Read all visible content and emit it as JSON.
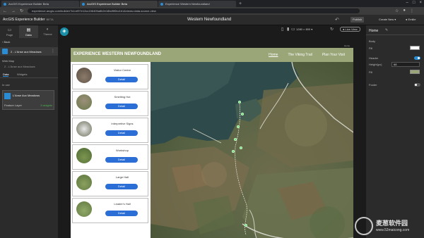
{
  "browser": {
    "tabs": [
      {
        "label": "ArcGIS Experience Builder Beta"
      },
      {
        "label": "ArcGIS Experience Builder Beta"
      },
      {
        "label": "Experience Western Newfoundland"
      }
    ],
    "url": "experience.arcgis.com/builder/?id=ef97e12cc156405a8b2e18bd9f0bc1b1&views=data-source-view"
  },
  "builder": {
    "app_title": "ArcGIS Experience Builder",
    "beta": "BETA",
    "page_title": "Western Newfoundland",
    "publish": "Publish",
    "create_new": "Create New",
    "user": "Emilie",
    "resolution": "1280 × 800",
    "live_view": "Live View",
    "page_label": "Home"
  },
  "left_rail": {
    "tabs": [
      {
        "label": "Page",
        "icon": "page-icon"
      },
      {
        "label": "Data",
        "icon": "data-icon"
      },
      {
        "label": "Theme",
        "icon": "theme-icon"
      }
    ]
  },
  "left_panel": {
    "back": "Back",
    "widget_name": "2 - L'Anse aux Meadows",
    "web_map_label": "Web Map",
    "web_map_item": "2 - L'Anse aux Meadows",
    "tabs": [
      "Data",
      "Widgets"
    ],
    "in_use": "In use",
    "data_source": {
      "name": "L'Anse Aux Meadows",
      "type": "Feature Layer",
      "widgets": "3 widgets"
    }
  },
  "site": {
    "title": "EXPERIENCE WESTERN NEWFOUNDLAND",
    "menu": [
      "Home",
      "The Viking Trail",
      "Plan Your Visit"
    ],
    "cards": [
      {
        "title": "Visitor Centre",
        "button": "Detail"
      },
      {
        "title": "Smelting Hut",
        "button": "Detail"
      },
      {
        "title": "Interpretive Signs",
        "button": "Detail"
      },
      {
        "title": "Workshop",
        "button": "Detail"
      },
      {
        "title": "Large Hall",
        "button": "Detail"
      },
      {
        "title": "Leader's Hall",
        "button": "Detail"
      }
    ]
  },
  "right_panel": {
    "title": "Home",
    "body_label": "Body",
    "fill_label": "Fill",
    "header_label": "Header",
    "height_label": "Height(px)",
    "height_value": "68",
    "header_fill_label": "Fill",
    "footer_label": "Footer",
    "header_color": "#9aa578",
    "body_color": "#ffffff"
  },
  "watermark": {
    "line1": "麦葱软件园",
    "line2": "www.52maicong.com"
  }
}
